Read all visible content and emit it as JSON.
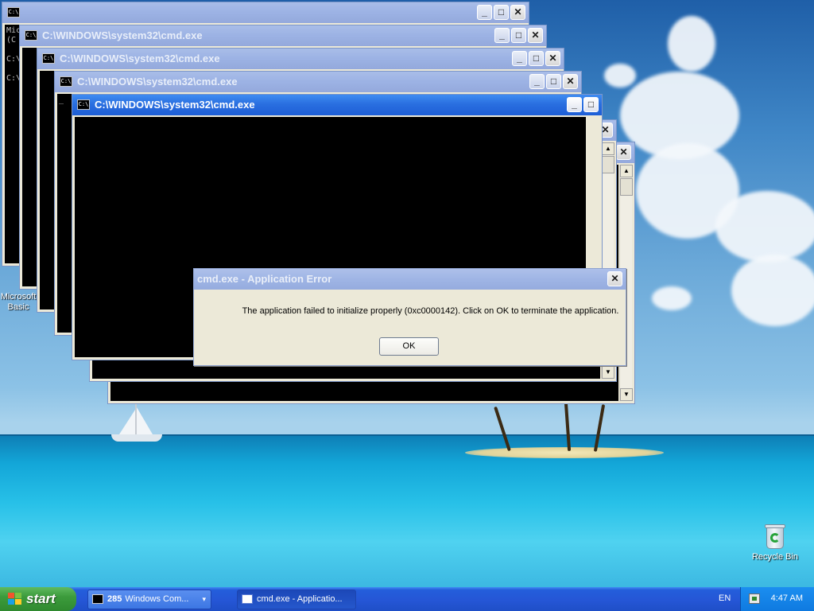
{
  "desktop": {
    "icons": {
      "msbasic_line1": "Microsoft",
      "msbasic_line2": "Basic",
      "recycle_bin": "Recycle Bin"
    }
  },
  "cmd_windows": [
    {
      "title": "",
      "console_text": "Mic\n(C\n\nC:\\\n\nC:\\"
    },
    {
      "title": "C:\\WINDOWS\\system32\\cmd.exe",
      "console_text": ""
    },
    {
      "title": "C:\\WINDOWS\\system32\\cmd.exe",
      "console_text": ""
    },
    {
      "title": "C:\\WINDOWS\\system32\\cmd.exe",
      "console_text": "_"
    },
    {
      "title": "C:\\WINDOWS\\system32\\cmd.exe",
      "console_text": ""
    }
  ],
  "icons": {
    "cmd_icon_text": "C:\\",
    "minimize": "_",
    "maximize": "□",
    "close": "✕",
    "scroll_up": "▲",
    "scroll_down": "▼"
  },
  "error_dialog": {
    "title": "cmd.exe - Application Error",
    "message": "The application failed to initialize properly (0xc0000142). Click on OK to terminate the application.",
    "ok_label": "OK"
  },
  "taskbar": {
    "start_label": "start",
    "tasks": [
      {
        "count": "285",
        "label": "Windows Com...",
        "caret": "▾"
      },
      {
        "label": "cmd.exe - Applicatio..."
      }
    ],
    "language": "EN",
    "clock": "4:47 AM"
  },
  "colors": {
    "xp_blue": "#245edb",
    "start_green": "#3c9b3c",
    "active_title": "#2a6fe0",
    "inactive_title": "#9cb2e4",
    "dialog_face": "#ece9d8"
  }
}
